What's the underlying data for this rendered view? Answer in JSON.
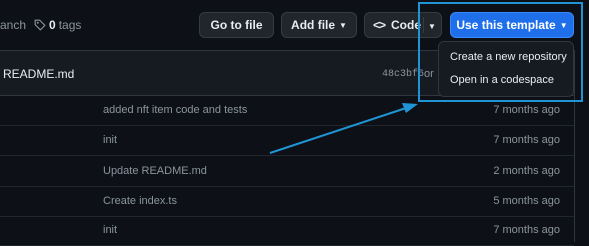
{
  "repo_meta": {
    "branch_fragment": "anch",
    "tags_count": "0",
    "tags_label": "tags"
  },
  "toolbar": {
    "go_to_file": "Go to file",
    "add_file": "Add file",
    "code": "Code",
    "use_template": "Use this template"
  },
  "template_menu": {
    "items": [
      {
        "label": "Create a new repository"
      },
      {
        "label": "Open in a codespace"
      }
    ]
  },
  "latest_commit": {
    "file": "README.md",
    "hash": "48c3bf6",
    "on_fragment": "or"
  },
  "files": [
    {
      "message": "added nft item code and tests",
      "age": "7 months ago"
    },
    {
      "message": "init",
      "age": "7 months ago"
    },
    {
      "message": "Update README.md",
      "age": "2 months ago"
    },
    {
      "message": "Create index.ts",
      "age": "5 months ago"
    },
    {
      "message": "init",
      "age": "7 months ago"
    }
  ],
  "colors": {
    "accent": "#1f6feb",
    "annotation": "#1f95d6",
    "background": "#0d1117"
  }
}
